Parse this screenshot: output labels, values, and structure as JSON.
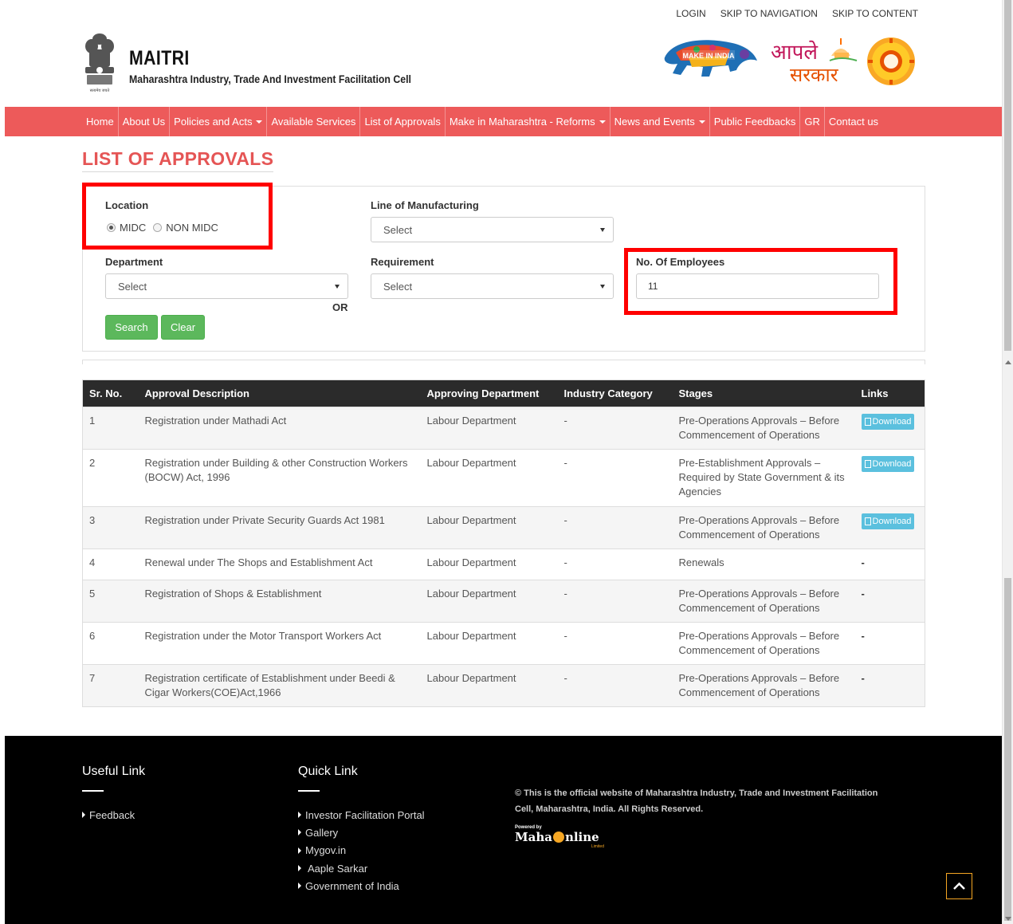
{
  "toplinks": [
    "LOGIN",
    "SKIP TO NAVIGATION",
    "SKIP TO CONTENT"
  ],
  "brand": {
    "title": "MAITRI",
    "subtitle": "Maharashtra Industry, Trade And Investment Facilitation Cell",
    "emblem_caption": "सत्यमेव जयते"
  },
  "logos": {
    "make_in_india": "MAKE IN INDIA",
    "aaple_line1": "आपले",
    "aaple_line2": "सरकार"
  },
  "nav": [
    {
      "label": "Home",
      "dropdown": false
    },
    {
      "label": "About Us",
      "dropdown": false
    },
    {
      "label": "Policies and Acts",
      "dropdown": true
    },
    {
      "label": "Available Services",
      "dropdown": false
    },
    {
      "label": "List of Approvals",
      "dropdown": false
    },
    {
      "label": "Make in Maharashtra - Reforms",
      "dropdown": true
    },
    {
      "label": "News and Events",
      "dropdown": true
    },
    {
      "label": "Public Feedbacks",
      "dropdown": false
    },
    {
      "label": "GR",
      "dropdown": false
    },
    {
      "label": "Contact us",
      "dropdown": false
    }
  ],
  "page_title": "LIST OF APPROVALS",
  "form": {
    "location_label": "Location",
    "location_options": [
      "MIDC",
      "NON MIDC"
    ],
    "location_selected": "MIDC",
    "line_label": "Line of Manufacturing",
    "line_value": "Select",
    "department_label": "Department",
    "department_value": "Select",
    "requirement_label": "Requirement",
    "requirement_value": "Select",
    "employees_label": "No. Of Employees",
    "employees_value": "11",
    "or_text": "OR",
    "search_label": "Search",
    "clear_label": "Clear"
  },
  "table": {
    "headers": [
      "Sr. No.",
      "Approval Description",
      "Approving Department",
      "Industry Category",
      "Stages",
      "Links"
    ],
    "download_label": "Download",
    "rows": [
      {
        "sr": "1",
        "desc": "Registration under Mathadi Act",
        "dept": "Labour Department",
        "cat": "-",
        "stage": "Pre-Operations Approvals – Before Commencement of Operations",
        "link": "Download"
      },
      {
        "sr": "2",
        "desc": "Registration under Building & other Construction Workers (BOCW) Act, 1996",
        "dept": "Labour Department",
        "cat": "-",
        "stage": "Pre-Establishment Approvals – Required by State Government & its Agencies",
        "link": "Download"
      },
      {
        "sr": "3",
        "desc": "Registration under Private Security Guards Act 1981",
        "dept": "Labour Department",
        "cat": "-",
        "stage": "Pre-Operations Approvals – Before Commencement of Operations",
        "link": "Download"
      },
      {
        "sr": "4",
        "desc": "Renewal under The Shops and Establishment Act",
        "dept": "Labour Department",
        "cat": "-",
        "stage": "Renewals",
        "link": "-"
      },
      {
        "sr": "5",
        "desc": "Registration of Shops & Establishment",
        "dept": "Labour Department",
        "cat": "-",
        "stage": "Pre-Operations Approvals – Before Commencement of Operations",
        "link": "-"
      },
      {
        "sr": "6",
        "desc": "Registration under the Motor Transport Workers Act",
        "dept": "Labour Department",
        "cat": "-",
        "stage": "Pre-Operations Approvals – Before Commencement of Operations",
        "link": "-"
      },
      {
        "sr": "7",
        "desc": "Registration certificate of Establishment under Beedi & Cigar Workers(COE)Act,1966",
        "dept": "Labour Department",
        "cat": "-",
        "stage": "Pre-Operations Approvals – Before Commencement of Operations",
        "link": "-"
      }
    ]
  },
  "footer": {
    "useful_heading": "Useful Link",
    "useful_links": [
      "Feedback"
    ],
    "quick_heading": "Quick Link",
    "quick_links": [
      "Investor Facilitation Portal",
      "Gallery",
      "Mygov.in",
      "Aaple Sarkar",
      "Government of India"
    ],
    "copyright": "© This is the official website of Maharashtra Industry, Trade and Investment Facilitation Cell, Maharashtra, India. All Rights Reserved.",
    "powered_by": "Powered by",
    "mahaonline_left": "Maha",
    "mahaonline_right": "nline",
    "mahaonline_sub": "Limited"
  },
  "colors": {
    "nav_bg": "#ed5a5a",
    "heading": "#e55555",
    "button_green": "#5cb85c",
    "download_blue": "#5bc0de",
    "highlight_red": "#ff0000",
    "footer_bg": "#000000"
  },
  "icons": [
    "back-to-top-icon",
    "chevron-up-icon",
    "download-document-icon",
    "caret-down-icon"
  ]
}
